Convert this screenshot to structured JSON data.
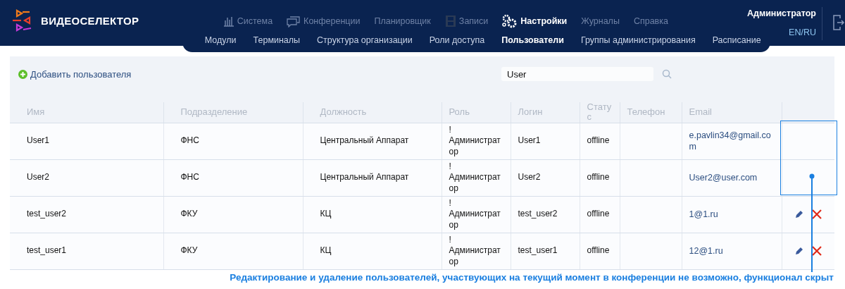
{
  "header": {
    "logo": "ВИДЕОСЕЛЕКТОР",
    "main_nav": [
      {
        "label": "Система",
        "kind": "chart",
        "selected": false
      },
      {
        "label": "Конференции",
        "kind": "chat",
        "selected": false
      },
      {
        "label": "Планировщик",
        "kind": "plain",
        "selected": false
      },
      {
        "label": "Записи",
        "kind": "film",
        "selected": false
      },
      {
        "label": "Настройки",
        "kind": "gears",
        "selected": true
      },
      {
        "label": "Журналы",
        "kind": "plain",
        "selected": false
      },
      {
        "label": "Справка",
        "kind": "plain",
        "selected": false
      }
    ],
    "sub_nav": [
      {
        "label": "Модули",
        "selected": false
      },
      {
        "label": "Терминалы",
        "selected": false
      },
      {
        "label": "Структура организации",
        "selected": false
      },
      {
        "label": "Роли доступа",
        "selected": false
      },
      {
        "label": "Пользователи",
        "selected": true
      },
      {
        "label": "Группы администрирования",
        "selected": false
      },
      {
        "label": "Расписание",
        "selected": false
      }
    ],
    "user": "Администратор",
    "language": "EN/RU"
  },
  "toolbar": {
    "add_button": "Добавить пользователя",
    "search": {
      "value": "User"
    }
  },
  "table": {
    "columns": [
      "Имя",
      "Подразделение",
      "Должность",
      "Роль",
      "Логин",
      "Статус",
      "Телефон",
      "Email"
    ],
    "rows": [
      {
        "cells": [
          "User1",
          "ФНС",
          "Центральный Аппарат",
          "! Администратор",
          "User1",
          "offline",
          "",
          "e.pavlin34@gmail.com"
        ],
        "editable": false
      },
      {
        "cells": [
          "User2",
          "ФНС",
          "Центральный Аппарат",
          "! Администратор",
          "User2",
          "offline",
          "",
          "User2@user.com"
        ],
        "editable": false
      },
      {
        "cells": [
          "test_user2",
          "ФКУ",
          "КЦ",
          "! Администратор",
          "test_user2",
          "offline",
          "",
          "1@1.ru"
        ],
        "editable": true
      },
      {
        "cells": [
          "test_user1",
          "ФКУ",
          "КЦ",
          "! Администратор",
          "test_user1",
          "offline",
          "",
          "12@1.ru"
        ],
        "editable": true
      }
    ]
  },
  "annotation": "Редактирование и удаление пользователей, участвующих на текущий момент в конференции не возможно, функционал скрыт"
}
